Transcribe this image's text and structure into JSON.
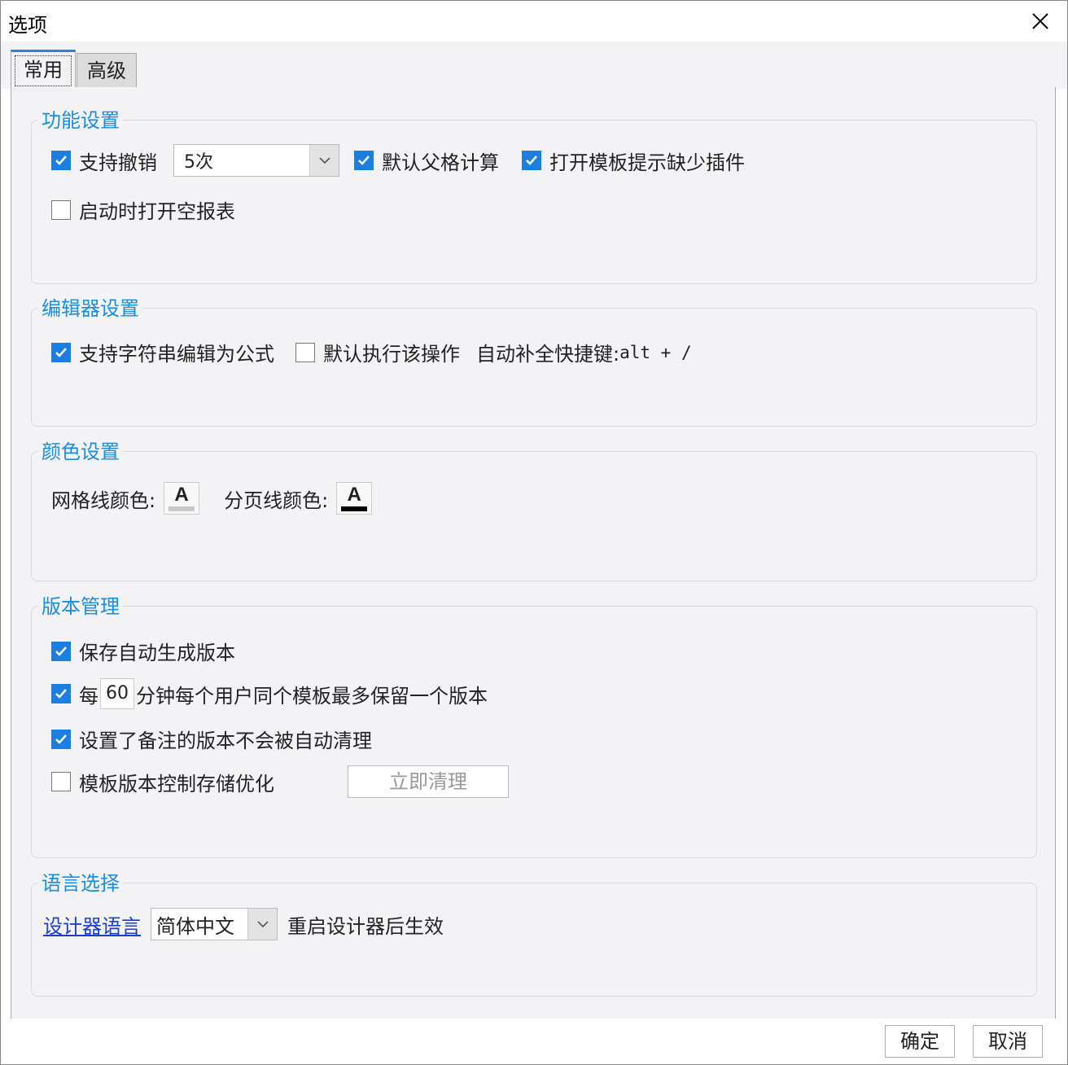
{
  "window": {
    "title": "选项",
    "close_icon": "close-icon"
  },
  "tabs": [
    {
      "label": "常用",
      "active": true
    },
    {
      "label": "高级",
      "active": false
    }
  ],
  "function_settings": {
    "title": "功能设置",
    "support_undo": {
      "label": "支持撤销",
      "checked": true
    },
    "undo_times": {
      "value": "5次"
    },
    "default_parent_cell_calc": {
      "label": "默认父格计算",
      "checked": true
    },
    "open_template_missing_plugin": {
      "label": "打开模板提示缺少插件",
      "checked": true
    },
    "open_empty_report_on_start": {
      "label": "启动时打开空报表",
      "checked": false
    }
  },
  "editor_settings": {
    "title": "编辑器设置",
    "string_as_formula": {
      "label": "支持字符串编辑为公式",
      "checked": true
    },
    "default_execute": {
      "label": "默认执行该操作",
      "checked": false
    },
    "autocomplete_label": "自动补全快捷键:",
    "autocomplete_shortcut": "alt + /"
  },
  "color_settings": {
    "title": "颜色设置",
    "grid_line_color_label": "网格线颜色:",
    "grid_line_color": "#c8c8c8",
    "page_line_color_label": "分页线颜色:",
    "page_line_color": "#000000",
    "letter": "A"
  },
  "version_management": {
    "title": "版本管理",
    "auto_generate_on_save": {
      "label": "保存自动生成版本",
      "checked": true
    },
    "keep_per_minutes": {
      "prefix": "每",
      "minutes": "60",
      "suffix": "分钟每个用户同个模板最多保留一个版本",
      "checked": true
    },
    "noted_not_cleaned": {
      "label": "设置了备注的版本不会被自动清理",
      "checked": true
    },
    "storage_optimize": {
      "label": "模板版本控制存储优化",
      "checked": false
    },
    "clean_now_button": "立即清理"
  },
  "language_selection": {
    "title": "语言选择",
    "designer_language_link": "设计器语言",
    "language_value": "简体中文",
    "restart_note": "重启设计器后生效"
  },
  "footer": {
    "ok_label": "确定",
    "cancel_label": "取消"
  },
  "colors": {
    "accent": "#1a8de0",
    "checkbox": "#1a7fe0",
    "link": "#1a3fcf",
    "panel_bg": "#f3f3f5"
  }
}
